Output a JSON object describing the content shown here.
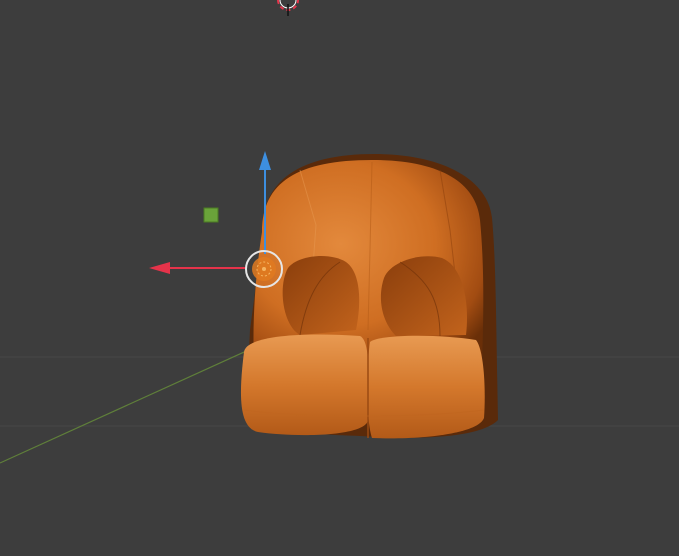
{
  "viewport": {
    "background_color": "#3d3d3d",
    "grid_line_color": "#474747",
    "x_axis_line_color": "#5f7f3a",
    "object_color": "#d4762a",
    "object_highlight_color": "#e89a52",
    "object_shadow_color": "#5a2a0a",
    "gizmo": {
      "z_axis_color": "#3d8fe0",
      "x_axis_color": "#e5334a",
      "plane_handle_color": "#6aa33a",
      "origin_icon": "object-origin-icon"
    },
    "cursor_icon": "3d-cursor-icon"
  }
}
